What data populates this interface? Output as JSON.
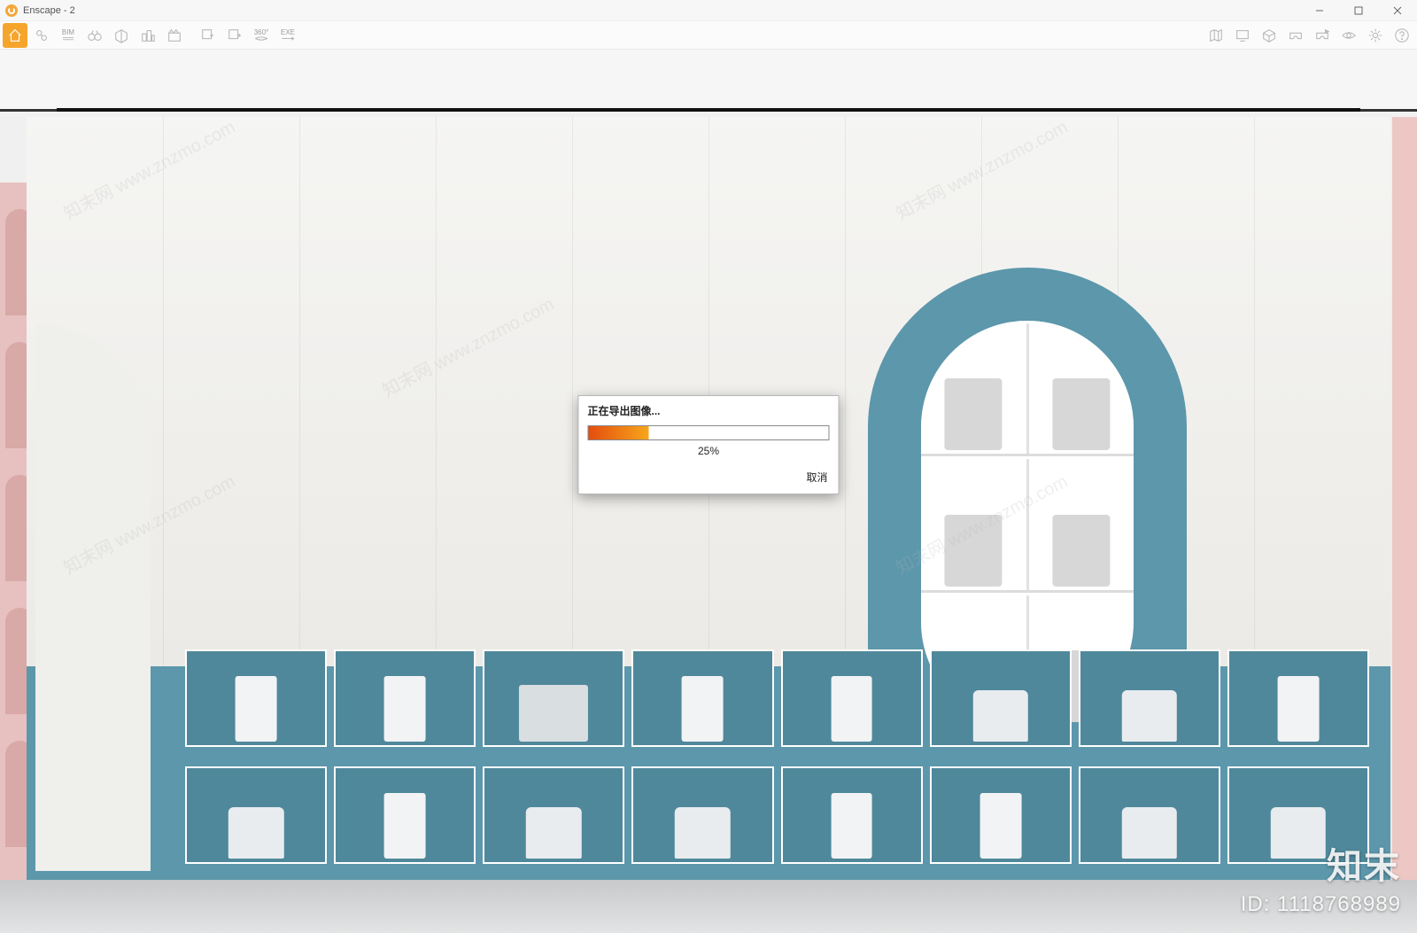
{
  "titlebar": {
    "app_name": "Enscape",
    "doc_name": "2",
    "full": "Enscape - 2"
  },
  "toolbar_left": [
    {
      "name": "home",
      "label": ""
    },
    {
      "name": "link",
      "label": ""
    },
    {
      "name": "bim",
      "label": "BIM"
    },
    {
      "name": "binoculars",
      "label": ""
    },
    {
      "name": "render-quality",
      "label": ""
    },
    {
      "name": "buildings",
      "label": ""
    },
    {
      "name": "clapper",
      "label": ""
    },
    {
      "name": "sep1",
      "label": ""
    },
    {
      "name": "export-in",
      "label": ""
    },
    {
      "name": "export-out",
      "label": ""
    },
    {
      "name": "pano360",
      "label": "360°"
    },
    {
      "name": "exe-export",
      "label": "EXE"
    }
  ],
  "toolbar_right": [
    {
      "name": "map",
      "label": ""
    },
    {
      "name": "monitor",
      "label": ""
    },
    {
      "name": "cube",
      "label": ""
    },
    {
      "name": "vr-headset",
      "label": ""
    },
    {
      "name": "vr-play",
      "label": ""
    },
    {
      "name": "visibility",
      "label": ""
    },
    {
      "name": "settings",
      "label": ""
    },
    {
      "name": "help",
      "label": ""
    }
  ],
  "dialog": {
    "title": "正在导出图像...",
    "percent_text": "25%",
    "percent_value": 25,
    "cancel": "取消"
  },
  "watermark": {
    "brand": "知末",
    "id_label": "ID: 1118768989",
    "url": "www.znzmo.com",
    "site": "知末网"
  }
}
